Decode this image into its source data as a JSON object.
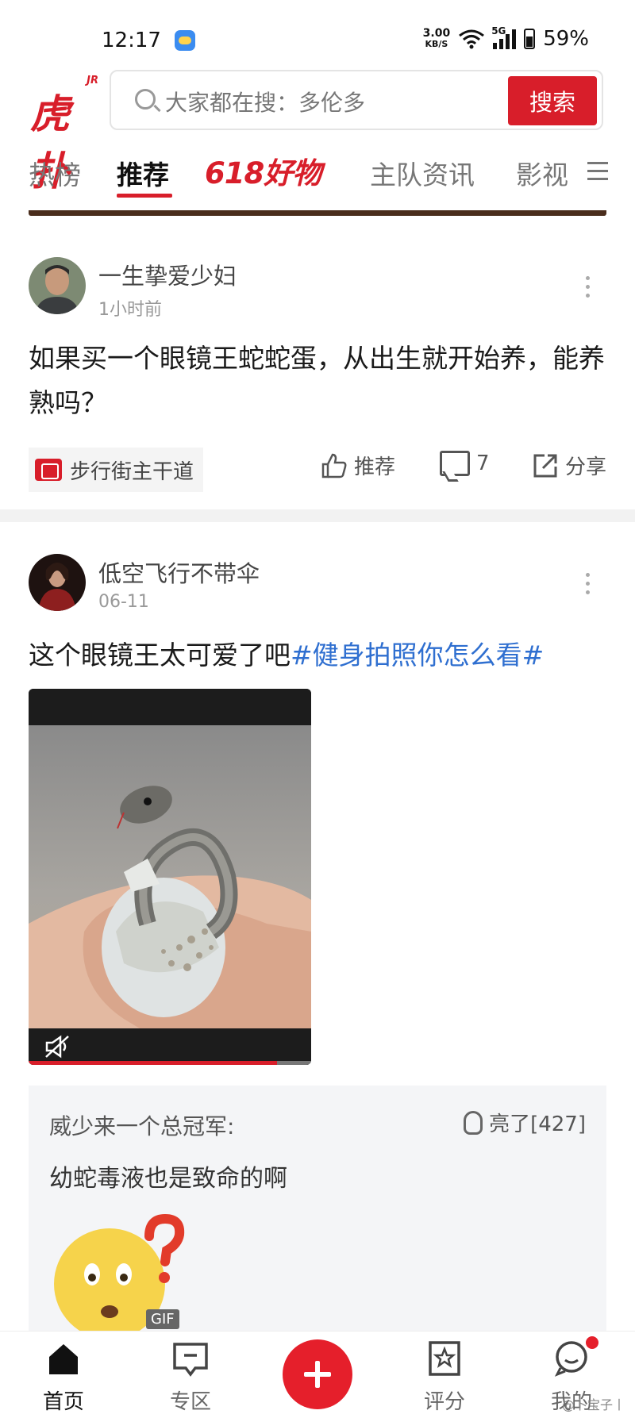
{
  "status_bar": {
    "time": "12:17",
    "net_speed_value": "3.00",
    "net_speed_unit": "KB/S",
    "network": "5G",
    "battery": "59%"
  },
  "header": {
    "logo_text": "虎扑",
    "logo_badge": "JR",
    "search_placeholder": "大家都在搜：多伦多",
    "search_button": "搜索"
  },
  "tabs": [
    {
      "label": "热榜"
    },
    {
      "label": "推荐"
    },
    {
      "label": "618好物"
    },
    {
      "label": "主队资讯"
    },
    {
      "label": "影视"
    }
  ],
  "posts": [
    {
      "author": "一生挚爱少妇",
      "time": "1小时前",
      "text": "如果买一个眼镜王蛇蛇蛋，从出生就开始养，能养熟吗？",
      "board": "步行街主干道",
      "actions": {
        "recommend": "推荐",
        "comments": "7",
        "share": "分享"
      }
    },
    {
      "author": "低空飞行不带伞",
      "time": "06-11",
      "text": "这个眼镜王太可爱了吧",
      "hashtag": "#健身拍照你怎么看#",
      "video_progress": 0.88,
      "comment": {
        "author": "威少来一个总冠军:",
        "lights": "亮了[427]",
        "text": "幼蛇毒液也是致命的啊",
        "badge": "GIF"
      }
    }
  ],
  "bottom_nav": [
    {
      "label": "首页",
      "icon": "home-icon"
    },
    {
      "label": "专区",
      "icon": "zone-icon"
    },
    {
      "label": "",
      "icon": "plus-icon"
    },
    {
      "label": "评分",
      "icon": "rating-icon"
    },
    {
      "label": "我的",
      "icon": "profile-icon"
    }
  ],
  "watermark": "@卜宝子丨",
  "colors": {
    "brand": "#d81e2a",
    "hashtag": "#2f6fd0",
    "background": "#ffffff"
  }
}
